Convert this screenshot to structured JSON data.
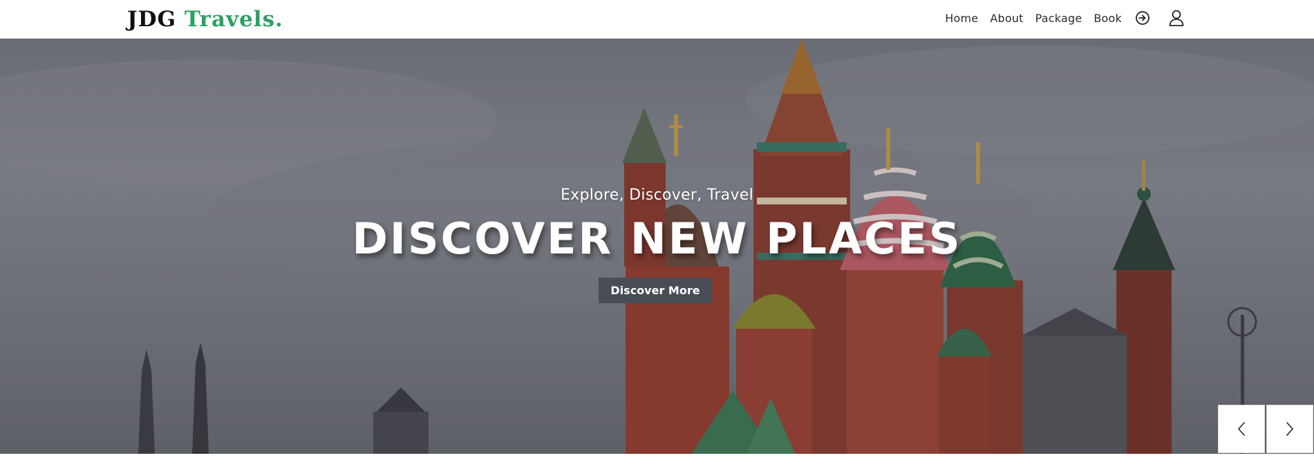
{
  "brand": {
    "name": "JDG",
    "accent": "Travels.",
    "accent_color": "#2aa163"
  },
  "nav": {
    "items": [
      {
        "label": "Home"
      },
      {
        "label": "About"
      },
      {
        "label": "Package"
      },
      {
        "label": "Book"
      }
    ],
    "icons": [
      "sign-in-icon",
      "user-icon"
    ]
  },
  "hero": {
    "subtitle": "Explore, Discover, Travel",
    "title": "DISCOVER NEW PLACES",
    "button_label": "Discover More"
  },
  "slider": {
    "prev_icon": "chevron-left-icon",
    "next_icon": "chevron-right-icon"
  }
}
